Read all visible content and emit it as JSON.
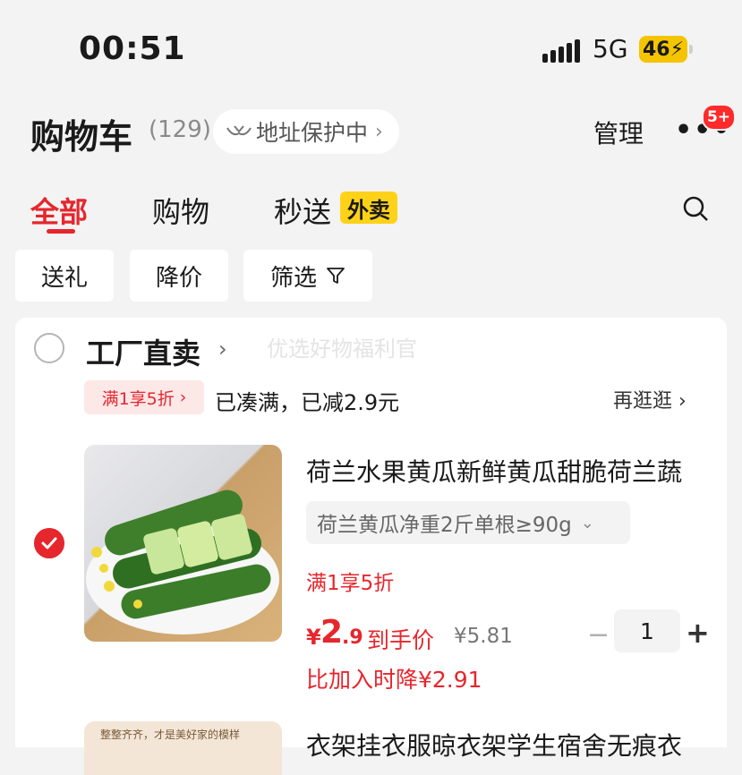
{
  "status_bar": {
    "time": "00:51",
    "network": "5G",
    "battery": "46"
  },
  "header": {
    "title": "购物车",
    "count": "(129)",
    "address_protect": "地址保护中",
    "manage": "管理",
    "more_badge": "5+"
  },
  "tabs": [
    {
      "label": "全部"
    },
    {
      "label": "购物"
    },
    {
      "label": "秒送"
    }
  ],
  "tab_tag": "外卖",
  "filters": [
    {
      "label": "送礼"
    },
    {
      "label": "降价"
    },
    {
      "label": "筛选"
    }
  ],
  "shop": {
    "name": "工厂直卖",
    "watermark": "优选好物福利官",
    "promo_chip": "满1享5折",
    "promo_text": "已凑满，已减2.9元",
    "browse": "再逛逛"
  },
  "item1": {
    "title": "荷兰水果黄瓜新鲜黄瓜甜脆荷兰蔬",
    "spec": "荷兰黄瓜净重2斤单根≥90g",
    "deal": "满1享5折",
    "price_symbol": "¥",
    "price_int": "2",
    "price_dec": ".9",
    "price_label": "到手价",
    "original_price": "¥5.81",
    "quantity": "1",
    "drop_note": "比加入时降¥2.91"
  },
  "item2": {
    "title": "衣架挂衣服晾衣架学生宿舍无痕衣",
    "thumb_text": "整整齐齐，才是美好家的模样"
  },
  "colors": {
    "accent": "#e6262d",
    "tag_yellow": "#ffd21a"
  }
}
